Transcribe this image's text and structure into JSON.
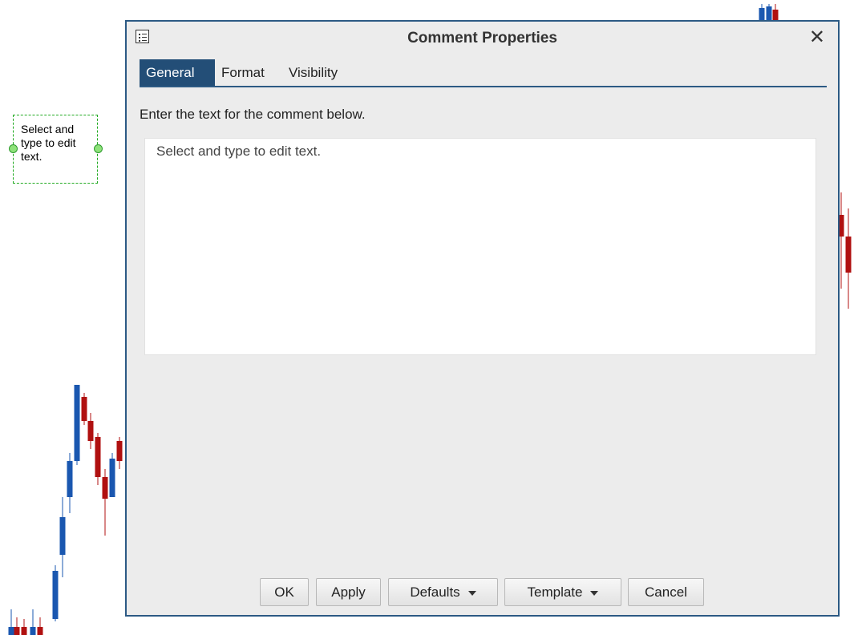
{
  "chart": {
    "comment_text": "Select and type to edit text.",
    "colors": {
      "up": "#1a57b0",
      "down": "#b01010"
    }
  },
  "dialog": {
    "title": "Comment Properties",
    "close_glyph": "✕",
    "tabs": [
      {
        "label": "General",
        "active": true
      },
      {
        "label": "Format",
        "active": false
      },
      {
        "label": "Visibility",
        "active": false
      }
    ],
    "instruction": "Enter the text for the comment below.",
    "comment_value": "Select and type to edit text.",
    "buttons": {
      "ok": "OK",
      "apply": "Apply",
      "defaults": "Defaults",
      "template": "Template",
      "cancel": "Cancel"
    },
    "accent_color": "#234e77"
  }
}
